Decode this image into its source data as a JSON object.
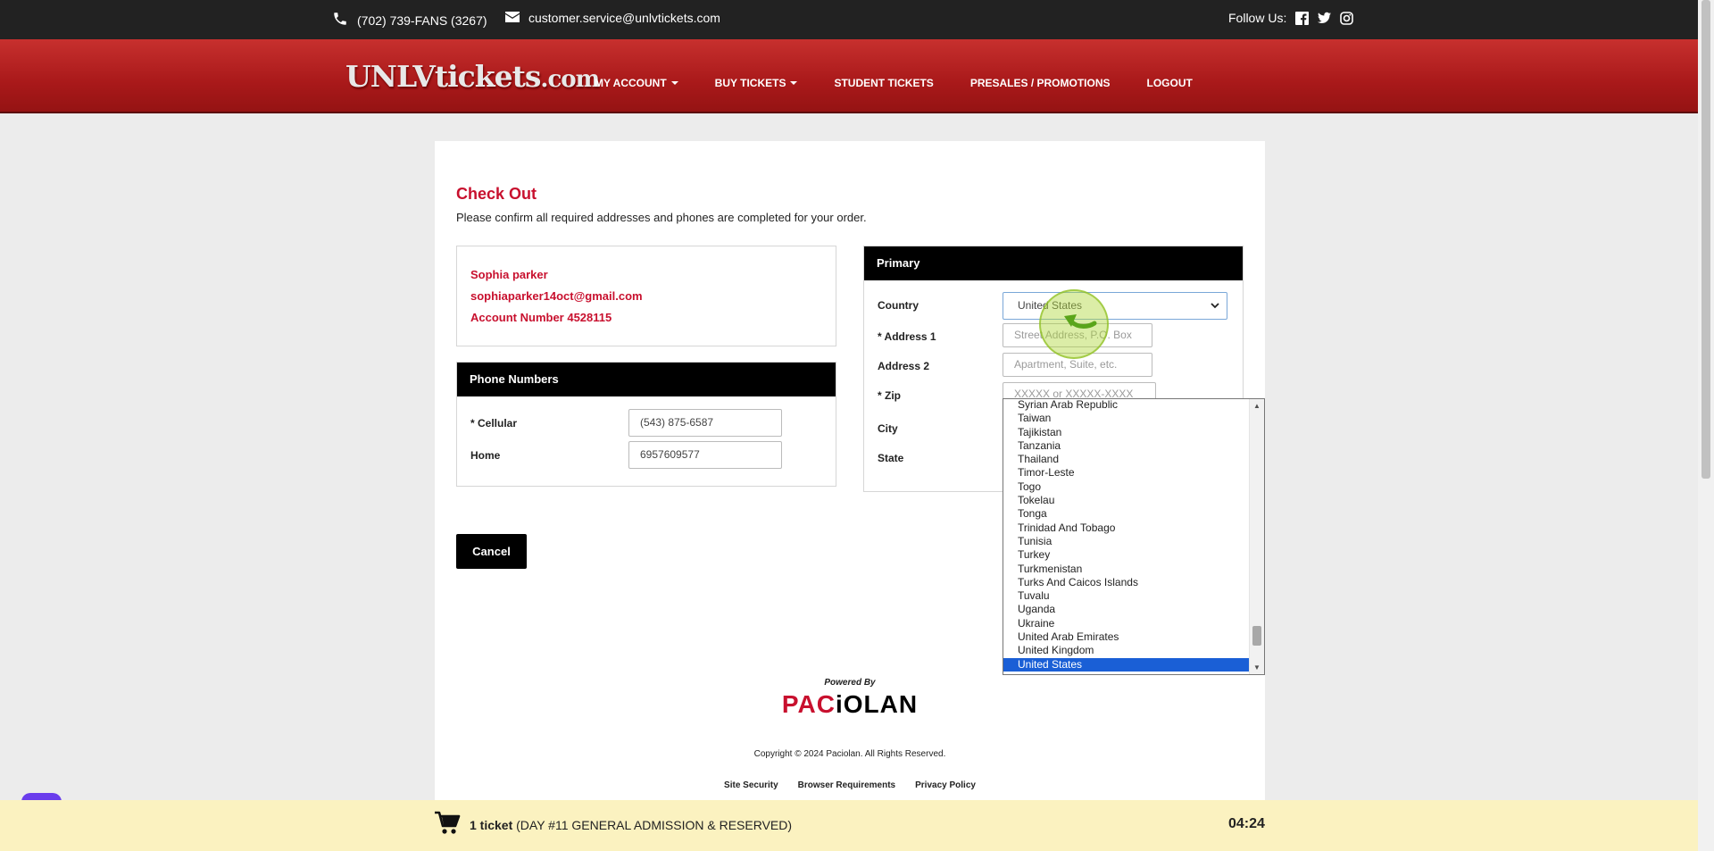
{
  "topbar": {
    "phone": "(702) 739-FANS (3267)",
    "email": "customer.service@unlvtickets.com",
    "follow_label": "Follow Us:",
    "social_icons": [
      "facebook-icon",
      "twitter-icon",
      "instagram-icon"
    ]
  },
  "nav": {
    "logo_main": "UNLV",
    "logo_accent": "tickets",
    "logo_suffix": ".com",
    "items": [
      {
        "label": "MY ACCOUNT",
        "has_caret": true
      },
      {
        "label": "BUY TICKETS",
        "has_caret": true
      },
      {
        "label": "STUDENT TICKETS",
        "has_caret": false
      },
      {
        "label": "PRESALES / PROMOTIONS",
        "has_caret": false
      },
      {
        "label": "LOGOUT",
        "has_caret": false
      }
    ]
  },
  "checkout": {
    "title": "Check Out",
    "subtitle": "Please confirm all required addresses and phones are completed for your order.",
    "user": {
      "name": "Sophia parker",
      "email": "sophiaparker14oct@gmail.com",
      "account": "Account Number 4528115"
    },
    "phones": {
      "header": "Phone Numbers",
      "cellular_label": "* Cellular",
      "cellular_value": "(543) 875-6587",
      "home_label": "Home",
      "home_value": "6957609577"
    },
    "primary": {
      "header": "Primary",
      "country_label": "Country",
      "country_value": "United States",
      "address1_label": "* Address 1",
      "address1_placeholder": "Street Address, P.O. Box",
      "address2_label": "Address 2",
      "address2_placeholder": "Apartment, Suite, etc.",
      "zip_label": "* Zip",
      "zip_placeholder": "XXXXX or XXXXX-XXXX",
      "city_label": "City",
      "state_label": "State"
    },
    "cancel_label": "Cancel"
  },
  "country_dropdown": {
    "options": [
      "Syrian Arab Republic",
      "Taiwan",
      "Tajikistan",
      "Tanzania",
      "Thailand",
      "Timor-Leste",
      "Togo",
      "Tokelau",
      "Tonga",
      "Trinidad And Tobago",
      "Tunisia",
      "Turkey",
      "Turkmenistan",
      "Turks And Caicos Islands",
      "Tuvalu",
      "Uganda",
      "Ukraine",
      "United Arab Emirates",
      "United Kingdom",
      "United States"
    ],
    "selected": "United States"
  },
  "footer": {
    "powered_by": "Powered By",
    "brand_part1": "PAC",
    "brand_part2": "iOLAN",
    "copyright": "Copyright © 2024 Paciolan. All Rights Reserved.",
    "links": [
      "Site Security",
      "Browser Requirements",
      "Privacy Policy"
    ]
  },
  "cart": {
    "count": "1 ticket",
    "description": "(DAY #11 GENERAL ADMISSION & RESERVED)",
    "timer": "04:24"
  },
  "colors": {
    "accent_red": "#c8102e",
    "nav_red": "#a9191a",
    "cart_bar": "#fbf2c0",
    "selection_blue": "#1a5fd6"
  }
}
